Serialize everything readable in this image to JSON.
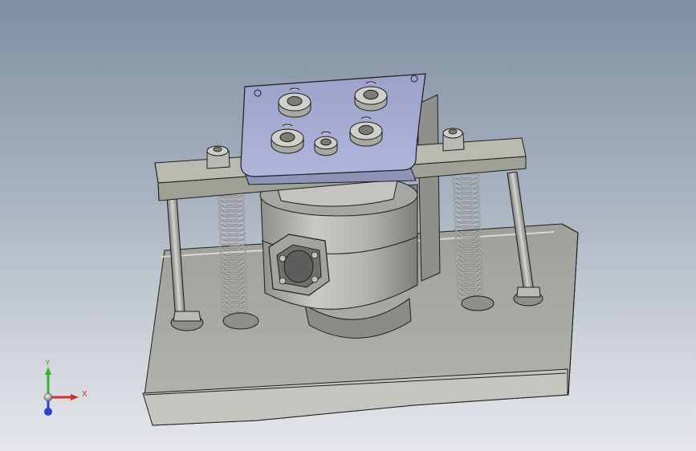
{
  "viewport": {
    "background_top": "#7f8fa3",
    "background_bottom": "#e4e6e9"
  },
  "model": {
    "base_plate_color": "#a8a9a3",
    "frame_color": "#b6b8ae",
    "top_plate_color": "#a9aed3",
    "cylinder_color": "#b4b4b0",
    "spring_color": "#d7d7d0",
    "edge_color": "#1e1e1e"
  },
  "triad": {
    "x_label": "X",
    "y_label": "Y",
    "x_color": "#d92b2b",
    "y_color": "#2fb52f",
    "z_color": "#2b3fd9"
  }
}
